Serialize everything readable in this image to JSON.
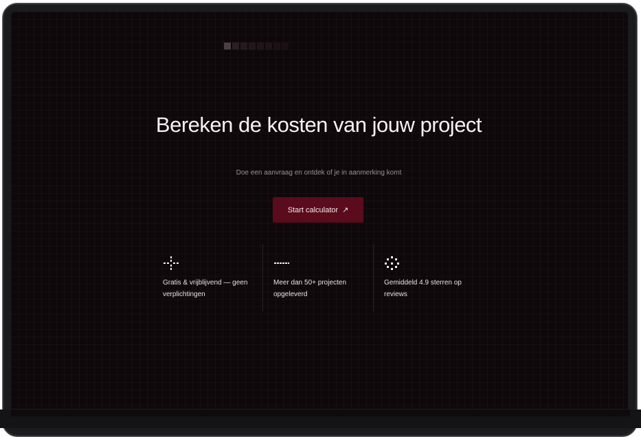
{
  "hero": {
    "title": "Bereken de kosten van jouw project",
    "subtitle": "Doe een aanvraag en ontdek of je in aanmerking komt"
  },
  "cta": {
    "label": "Start calculator",
    "icon": "arrow-up-right-icon"
  },
  "progress": {
    "total_steps": 8,
    "current_step": 1
  },
  "features": [
    {
      "icon": "sparkle-icon",
      "text": "Gratis & vrijblijvend — geen verplichtingen"
    },
    {
      "icon": "dash-icon",
      "text": "Meer dan 50+ projecten opgeleverd"
    },
    {
      "icon": "dotted-circle-icon",
      "text": "Gemiddeld 4.9 sterren op reviews"
    }
  ],
  "colors": {
    "background": "#0f080a",
    "accent": "#5a0c1c",
    "text": "#f5f1f1",
    "muted": "#9a9093"
  }
}
